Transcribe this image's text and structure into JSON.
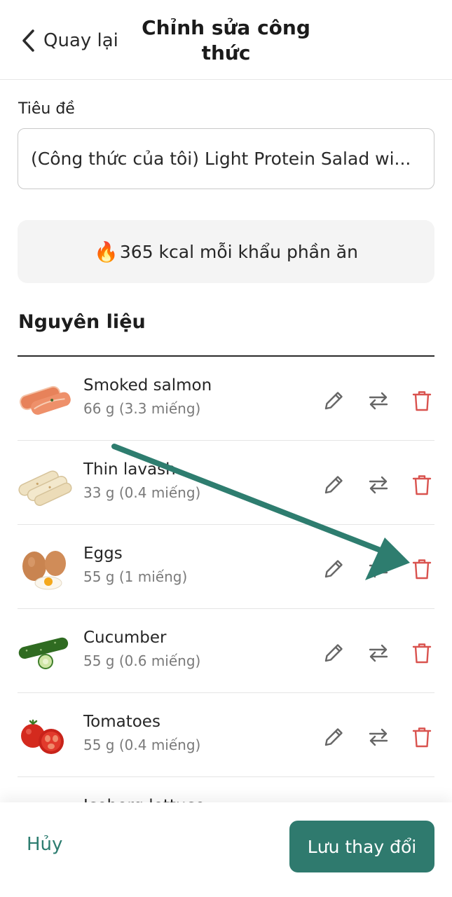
{
  "header": {
    "back_label": "Quay lại",
    "title": "Chỉnh sửa công thức"
  },
  "title_field": {
    "label": "Tiêu đề",
    "value": "(Công thức của tôi) Light Protein Salad wi..."
  },
  "calories": {
    "icon": "fire-emoji",
    "text": "365 kcal mỗi khẩu phần ăn"
  },
  "ingredients": {
    "heading": "Nguyên liệu",
    "items": [
      {
        "name": "Smoked salmon",
        "quantity": "66 g (3.3 miếng)",
        "image": "smoked-salmon"
      },
      {
        "name": "Thin lavash",
        "quantity": "33 g (0.4 miếng)",
        "image": "lavash-rolls"
      },
      {
        "name": "Eggs",
        "quantity": "55 g (1 miếng)",
        "image": "eggs"
      },
      {
        "name": "Cucumber",
        "quantity": "55 g (0.6 miếng)",
        "image": "cucumber"
      },
      {
        "name": "Tomatoes",
        "quantity": "55 g (0.4 miếng)",
        "image": "tomatoes"
      },
      {
        "name": "Iceberg lettuce",
        "quantity": "",
        "image": "lettuce"
      }
    ]
  },
  "footer": {
    "cancel_label": "Hủy",
    "save_label": "Lưu thay đổi"
  },
  "colors": {
    "accent": "#2f7a6e",
    "delete": "#d9534f",
    "annotation_arrow": "#2e7d6f"
  }
}
